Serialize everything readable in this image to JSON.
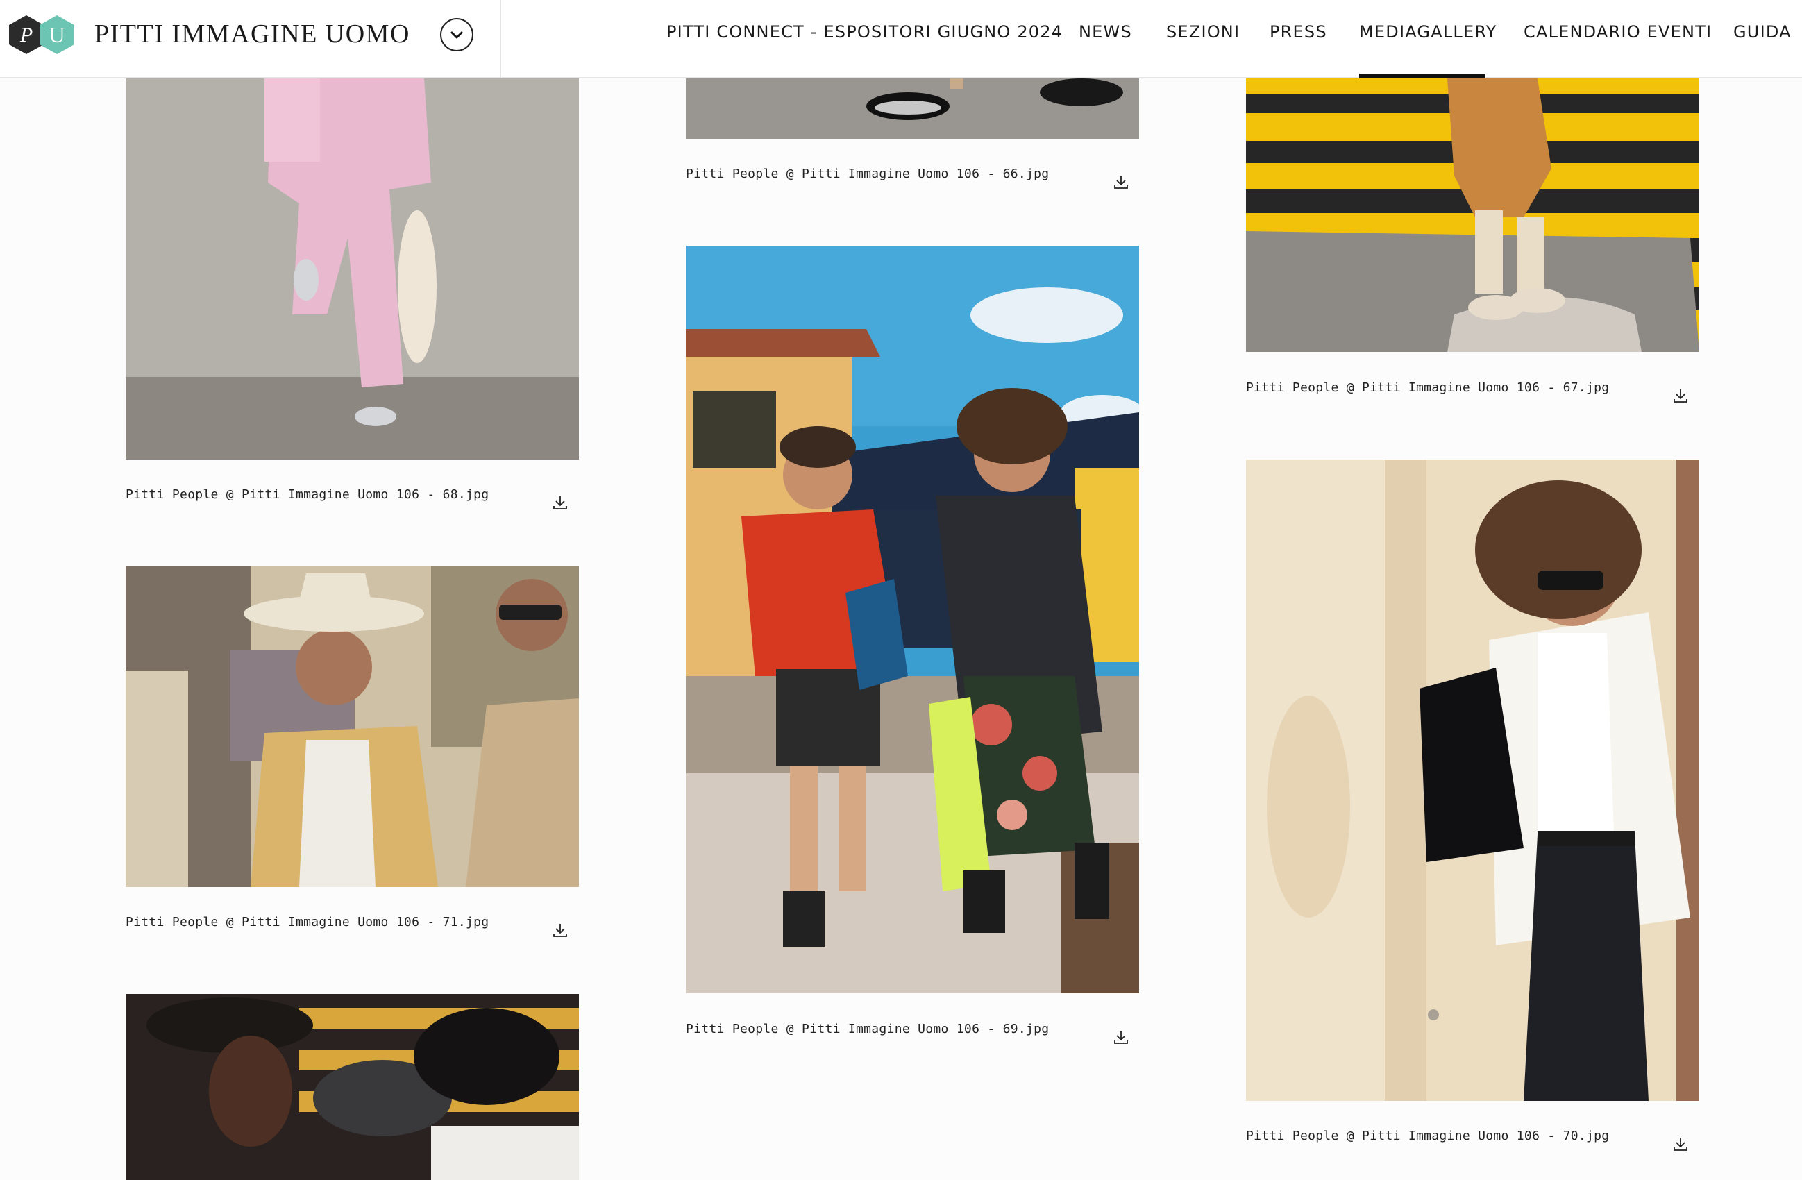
{
  "header": {
    "brand_title": "PITTI IMMAGINE UOMO",
    "logo_letters": [
      "P",
      "U"
    ],
    "nav": [
      "PITTI CONNECT - ESPOSITORI GIUGNO 2024",
      "NEWS",
      "SEZIONI",
      "PRESS",
      "MEDIAGALLERY",
      "CALENDARIO EVENTI",
      "GUIDA"
    ],
    "active_nav": "MEDIAGALLERY"
  },
  "gallery": {
    "captions": {
      "img66": "Pitti People @ Pitti Immagine Uomo 106 - 66.jpg",
      "img67": "Pitti People @ Pitti Immagine Uomo 106 - 67.jpg",
      "img68": "Pitti People @ Pitti Immagine Uomo 106 - 68.jpg",
      "img69": "Pitti People @ Pitti Immagine Uomo 106 - 69.jpg",
      "img70": "Pitti People @ Pitti Immagine Uomo 106 - 70.jpg",
      "img71": "Pitti People @ Pitti Immagine Uomo 106 - 71.jpg"
    }
  },
  "icons": {
    "dropdown": "chevron-down-icon",
    "download": "download-icon"
  },
  "colors": {
    "logo_dark": "#2b2b2b",
    "logo_teal": "#6cc5b2",
    "active_underline": "#111111"
  }
}
